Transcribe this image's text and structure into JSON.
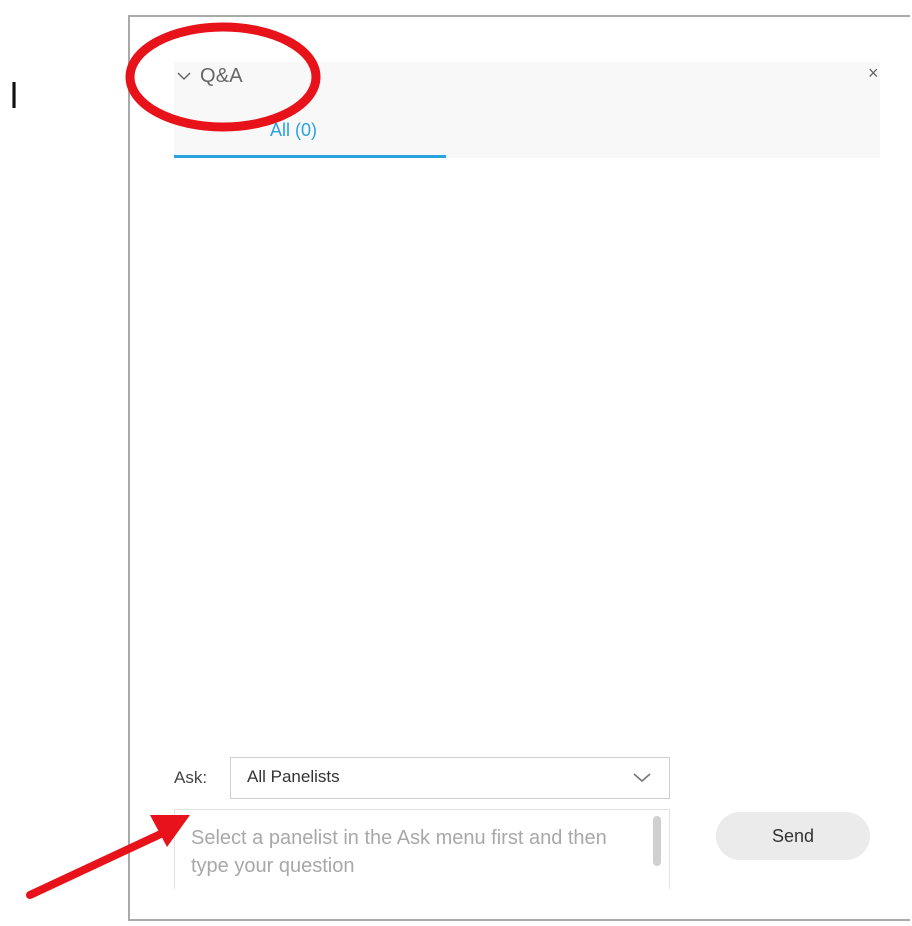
{
  "stray_text": "l",
  "panel": {
    "title": "Q&A",
    "collapse_icon": "chevron-down-icon",
    "close_symbol": "×",
    "tabs": [
      {
        "label": "All (0)",
        "selected": true
      }
    ],
    "ask": {
      "label": "Ask:",
      "selected": "All Panelists"
    },
    "question_input": {
      "placeholder": "Select a panelist in the Ask menu first and then type your question"
    },
    "send_label": "Send"
  },
  "colors": {
    "accent": "#29a3e0",
    "annotation_red": "#e8121b"
  }
}
